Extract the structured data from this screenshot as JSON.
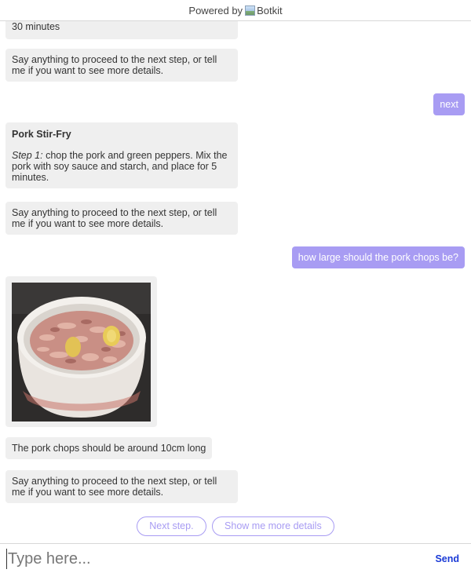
{
  "header": {
    "powered_by": "Powered by",
    "brand": "Botkit"
  },
  "messages": {
    "m0_text": "30 minutes",
    "m1_text": "Say anything to proceed to the next step, or tell me if you want to see more details.",
    "u1_text": "next",
    "m2_title": "Pork Stir-Fry",
    "m2_step_label": "Step 1:",
    "m2_step_text": " chop the pork and green peppers. Mix the pork with soy sauce and starch, and place for 5 minutes.",
    "m3_text": "Say anything to proceed to the next step, or tell me if you want to see more details.",
    "u2_text": "how large should the pork chops be?",
    "m5_text": "The pork chops should be around 10cm long",
    "m6_text": "Say anything to proceed to the next step, or tell me if you want to see more details."
  },
  "quick_replies": {
    "next": "Next step.",
    "details": "Show me more details"
  },
  "input": {
    "placeholder": "Type here...",
    "send_label": "Send"
  },
  "colors": {
    "accent": "#a89cf3",
    "bot_bubble": "#efefef",
    "send_link": "#1a3ad6"
  }
}
